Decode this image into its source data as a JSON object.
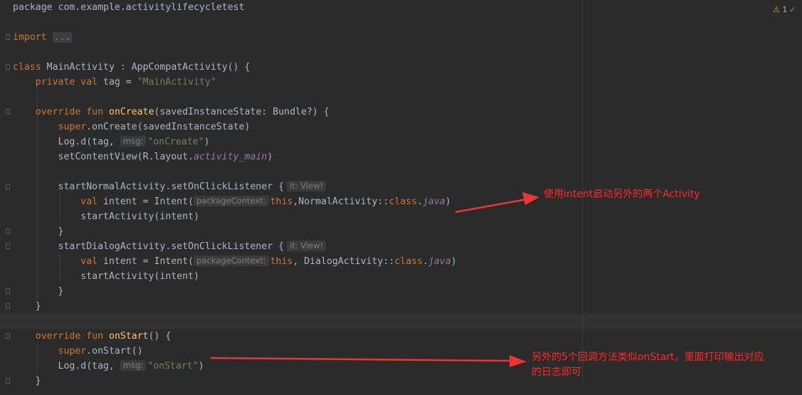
{
  "status": {
    "warning_count": "1",
    "warning_icon": "⚠",
    "ok_icon": "✓"
  },
  "code": {
    "l1": "package com.example.activitylifecycletest",
    "l2_kw": "import",
    "l2_dots": "...",
    "l3_kw": "class",
    "l3_rest": " MainActivity : AppCompatActivity() {",
    "l4_kw": "private val",
    "l4_mid": " tag = ",
    "l4_str": "\"MainActivity\"",
    "l5_kw": "override fun",
    "l5_fn": "onCreate",
    "l5_rest": "(savedInstanceState: Bundle?) {",
    "l6_kw": "super",
    "l6_rest": ".onCreate(savedInstanceState)",
    "l7_pre": "Log.d(tag,",
    "l7_hint": "msg:",
    "l7_str": "\"onCreate\"",
    "l7_post": ")",
    "l8_pre": "setContentView(R.layout.",
    "l8_itl": "activity_main",
    "l8_post": ")",
    "l9_pre": "startNormalActivity.setOnClickListener {",
    "l9_hint": "it: View!",
    "l10_kw": "val",
    "l10_mid": " intent = Intent(",
    "l10_hint": "packageContext:",
    "l10_this": "this",
    "l10_mid2": ",NormalActivity::",
    "l10_class": "class",
    "l10_dot": ".",
    "l10_java": "java",
    "l10_post": ")",
    "l11": "startActivity(intent)",
    "l12": "}",
    "l13_pre": "startDialogActivity.setOnClickListener {",
    "l13_hint": "it: View!",
    "l14_kw": "val",
    "l14_mid": " intent = Intent(",
    "l14_hint": "packageContext:",
    "l14_this": "this",
    "l14_mid2": ", DialogActivity::",
    "l14_class": "class",
    "l14_dot": ".",
    "l14_java": "java",
    "l14_post": ")",
    "l15": "startActivity(intent)",
    "l16": "}",
    "l17": "}",
    "l18_kw": "override fun",
    "l18_fn": "onStart",
    "l18_rest": "() {",
    "l19_kw": "super",
    "l19_rest": ".onStart()",
    "l20_pre": "Log.d(tag,",
    "l20_hint": "msg:",
    "l20_str": "\"onStart\"",
    "l20_post": ")",
    "l21": "}"
  },
  "annotations": {
    "a1": "使用intent启动另外的两个Activity",
    "a2_line1": "另外的5个回调方法类似onStart，里面打印输出对应",
    "a2_line2": "的日志即可",
    "color": "#ff2b2b"
  }
}
